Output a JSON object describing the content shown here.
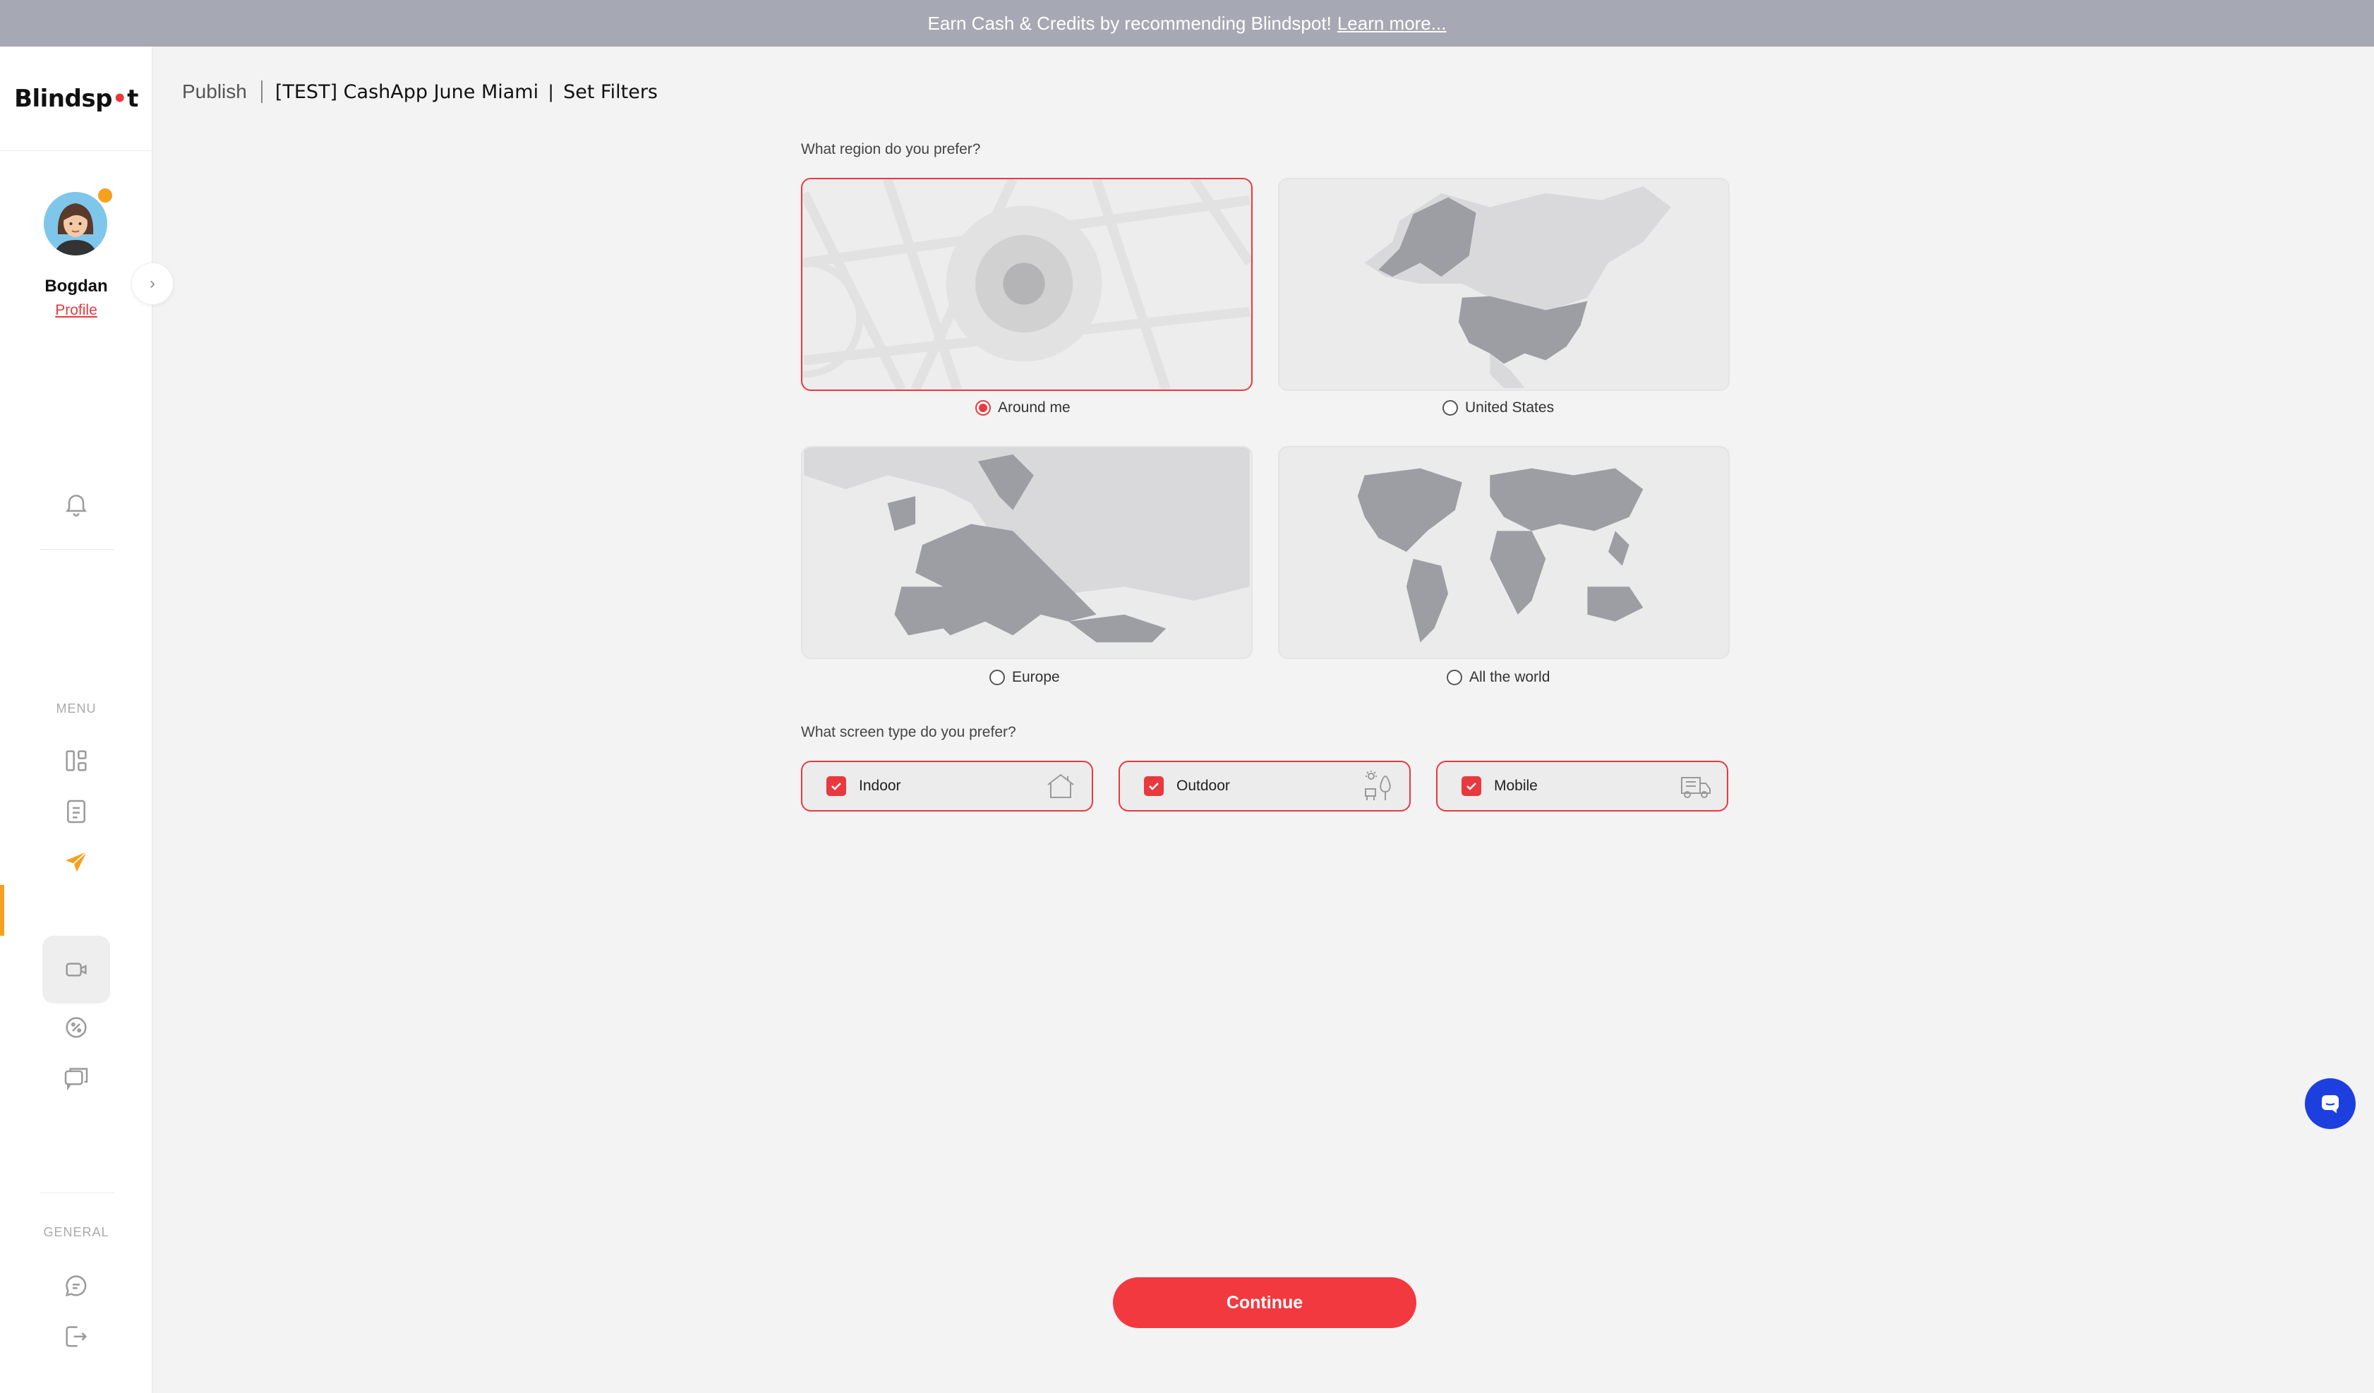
{
  "banner": {
    "text": "Earn Cash & Credits by recommending Blindspot!",
    "link": "Learn more..."
  },
  "sidebar": {
    "logo_left": "Blindsp",
    "logo_dot": "•",
    "logo_right": "t",
    "user_name": "Bogdan",
    "profile_link": "Profile",
    "menu_label": "MENU",
    "general_label": "GENERAL",
    "icons": [
      "bell-icon",
      "dashboard-icon",
      "document-icon",
      "send-icon",
      "camera-icon",
      "discount-icon",
      "chat-bubbles-icon",
      "message-icon",
      "logout-icon"
    ]
  },
  "header": {
    "root": "Publish",
    "campaign": "[TEST] CashApp June Miami",
    "separator": "|",
    "step": "Set Filters"
  },
  "region": {
    "question": "What region do you prefer?",
    "options": [
      {
        "label": "Around me",
        "selected": true
      },
      {
        "label": "United States",
        "selected": false
      },
      {
        "label": "Europe",
        "selected": false
      },
      {
        "label": "All the world",
        "selected": false
      }
    ]
  },
  "screen_type": {
    "question": "What screen type do you prefer?",
    "options": [
      {
        "label": "Indoor",
        "checked": true,
        "icon": "house-icon"
      },
      {
        "label": "Outdoor",
        "checked": true,
        "icon": "outdoor-billboard-icon"
      },
      {
        "label": "Mobile",
        "checked": true,
        "icon": "truck-icon"
      }
    ]
  },
  "actions": {
    "continue": "Continue"
  },
  "colors": {
    "accent": "#e8393f",
    "banner": "#a6a8b3",
    "active_menu": "#f5a11e",
    "chat": "#1e3fe0"
  }
}
